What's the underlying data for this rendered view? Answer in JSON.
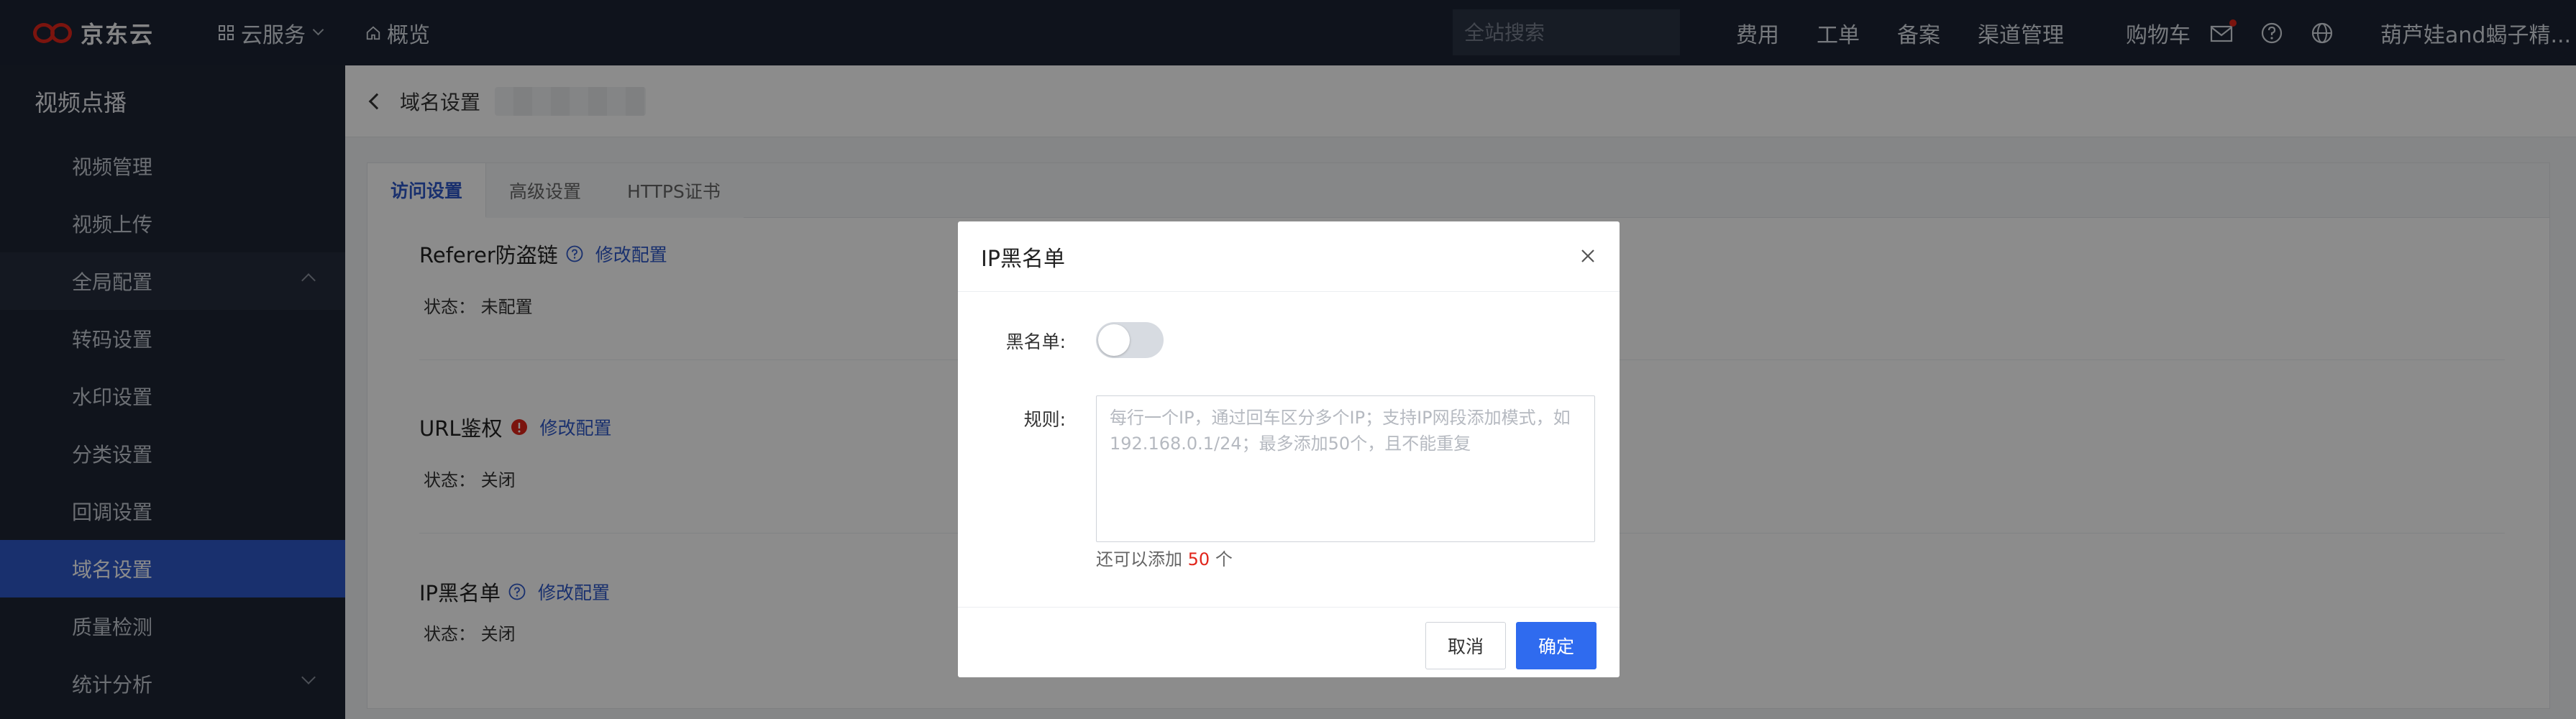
{
  "topbar": {
    "logo_text": "京东云",
    "services_label": "云服务",
    "overview_label": "概览",
    "search_placeholder": "全站搜索",
    "links": [
      "费用",
      "工单",
      "备案",
      "渠道管理",
      "购物车"
    ],
    "user_name": "葫芦娃and蝎子精...",
    "accent_color": "#e1251b"
  },
  "sidebar": {
    "title": "视频点播",
    "items": [
      {
        "label": "视频管理"
      },
      {
        "label": "视频上传"
      },
      {
        "label": "全局配置"
      },
      {
        "label": "转码设置"
      },
      {
        "label": "水印设置"
      },
      {
        "label": "分类设置"
      },
      {
        "label": "回调设置"
      },
      {
        "label": "域名设置"
      },
      {
        "label": "质量检测"
      },
      {
        "label": "统计分析"
      }
    ],
    "active_color": "#2f58c8"
  },
  "main": {
    "breadcrumb": "域名设置",
    "tabs": [
      "访问设置",
      "高级设置",
      "HTTPS证书"
    ],
    "sections": [
      {
        "title": "Referer防盗链",
        "edit_label": "修改配置",
        "status_label": "状态：",
        "status_value": "未配置"
      },
      {
        "title": "URL鉴权",
        "edit_label": "修改配置",
        "status_label": "状态：",
        "status_value": "关闭"
      },
      {
        "title": "IP黑名单",
        "edit_label": "修改配置",
        "status_label": "状态：",
        "status_value": "关闭"
      }
    ]
  },
  "modal": {
    "title": "IP黑名单",
    "blacklist_label": "黑名单:",
    "blacklist_enabled": false,
    "rules_label": "规则:",
    "rules_placeholder": "每行一个IP，通过回车区分多个IP；支持IP网段添加模式，如192.168.0.1/24；最多添加50个，且不能重复",
    "remaining_prefix": "还可以添加",
    "remaining_count": "50",
    "remaining_suffix": "个",
    "cancel_label": "取消",
    "ok_label": "确定",
    "primary_color": "#2f6bef"
  }
}
